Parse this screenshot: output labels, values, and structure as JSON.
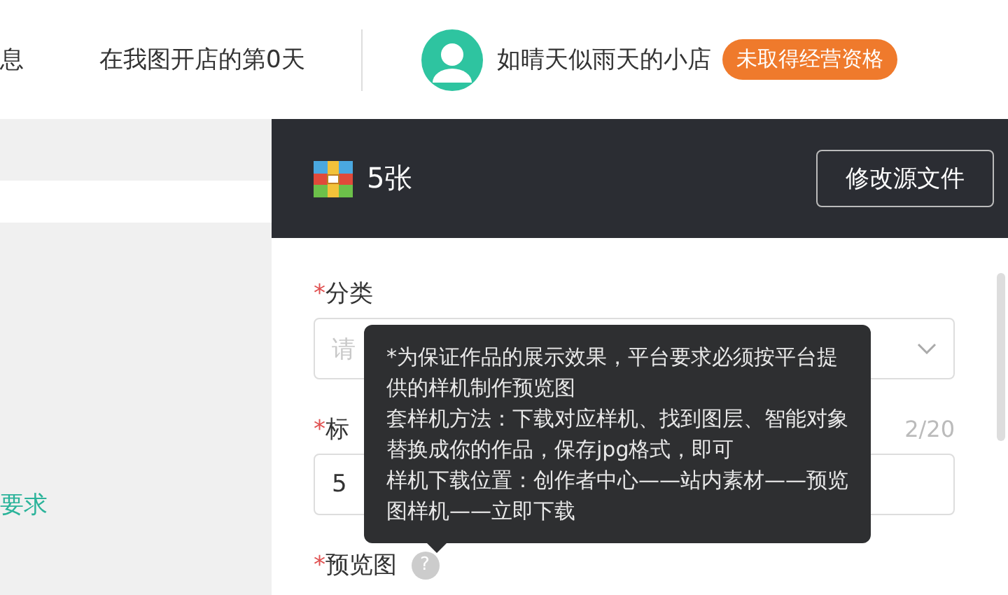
{
  "header": {
    "nav_partial": "息",
    "days_text": "在我图开店的第0天",
    "shop_name": "如晴天似雨天的小店",
    "status_badge": "未取得经营资格"
  },
  "left": {
    "link_partial": "要求"
  },
  "panel": {
    "title": "5张",
    "edit_button": "修改源文件",
    "fields": [
      {
        "kind": "select",
        "label": "分类",
        "required_mark": "*",
        "placeholder": "请"
      },
      {
        "kind": "input",
        "label": "标",
        "required_mark": "*",
        "counter": "2/20",
        "value": "5"
      },
      {
        "kind": "help",
        "label": "预览图",
        "required_mark": "*",
        "help": "?"
      }
    ]
  },
  "tooltip": {
    "paragraphs": [
      "*为保证作品的展示效果，平台要求必须按平台提供的样机制作预览图",
      "套样机方法：下载对应样机、找到图层、智能对象替换成你的作品，保存jpg格式，即可",
      "样机下载位置：创作者中心——站内素材——预览图样机——立即下载"
    ]
  }
}
